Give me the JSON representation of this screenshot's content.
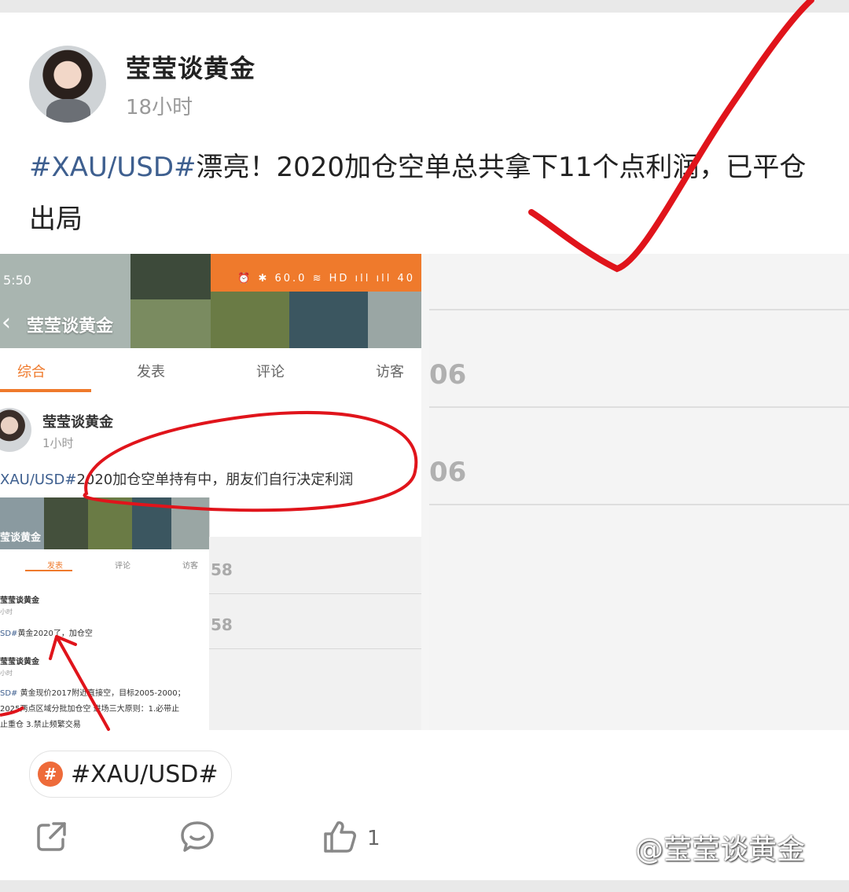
{
  "post": {
    "author": "莹莹谈黄金",
    "time": "18小时",
    "tag": "#XAU/USD#",
    "text": "漂亮！2020加仓空单总共拿下11个点利润，已平仓出局"
  },
  "embedded": {
    "status_time": "5:50",
    "status_icons": "⏰ ✱ 60.0 ≋ HD ıll ıll 40",
    "profile_name": "莹莹谈黄金",
    "tabs": [
      "综合",
      "发表",
      "评论",
      "访客"
    ],
    "post_author": "莹莹谈黄金",
    "post_time": "1小时",
    "post_tag": "XAU/USD#",
    "post_text": "2020加仓空单持有中，朋友们自行决定利润",
    "right_numbers": [
      "06",
      "06"
    ],
    "strip_numbers": [
      "58",
      "58"
    ],
    "nested": {
      "profile_name": "莹谈黄金",
      "tabs": [
        "发表",
        "评论",
        "访客"
      ],
      "author1": "莹莹谈黄金",
      "time1": "小时",
      "text1_tag": "SD#",
      "text1": "黄金2020了，加仓空",
      "author2": "莹莹谈黄金",
      "time2": "小时",
      "text2_tag": "SD#",
      "text2a": " 黄金现价2017附近直接空，目标2005-2000；",
      "text2b": "2025两点区域分批加仓空 进场三大原则：1.必带止",
      "text2c": "止重仓 3.禁止频繁交易"
    }
  },
  "topic": {
    "label": "#XAU/USD#",
    "icon": "#"
  },
  "actions": {
    "like_count": "1"
  },
  "watermark": "@莹莹谈黄金",
  "colors": {
    "accent": "#ef7a2c",
    "tag": "#3e5f8f",
    "mark_red": "#e0141b"
  }
}
